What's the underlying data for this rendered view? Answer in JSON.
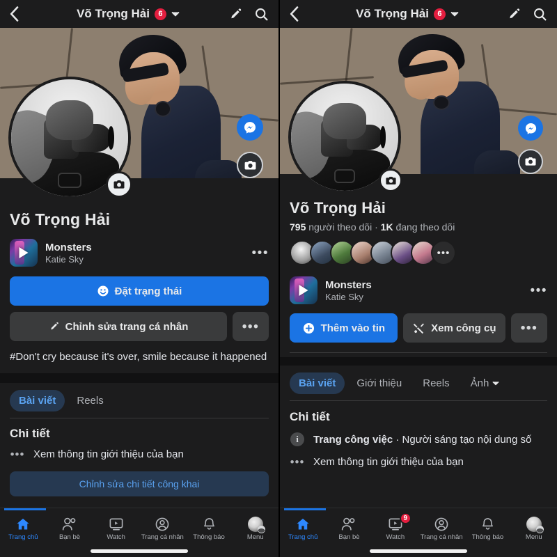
{
  "header": {
    "back_icon": "chevron-left-icon",
    "title": "Võ Trọng Hải",
    "badge": "6",
    "chevron_icon": "chevron-down-icon",
    "edit_icon": "pencil-icon",
    "search_icon": "search-icon"
  },
  "cover": {
    "messenger_icon": "messenger-icon",
    "camera_icon": "camera-icon",
    "avatar_camera_icon": "camera-icon",
    "alt": "man in navy shirt sitting on rocks adjusting sunglasses"
  },
  "profile": {
    "name": "Võ Trọng Hải",
    "followers_count": "795",
    "followers_label": "người theo dõi",
    "separator": "·",
    "following_count": "1K",
    "following_label": "đang theo dõi",
    "friends_more": "•••"
  },
  "music": {
    "title": "Monsters",
    "artist": "Katie Sky",
    "play_icon": "play-icon",
    "more_icon": "ellipsis-icon",
    "more_label": "•••"
  },
  "left_panel": {
    "status_button": "Đặt trạng thái",
    "status_icon": "smiley-icon",
    "edit_profile_button": "Chỉnh sửa trang cá nhân",
    "edit_profile_icon": "pencil-icon",
    "overflow_label": "•••",
    "bio": "#Don't cry because it's over, smile because it happened",
    "tabs": [
      {
        "label": "Bài viết",
        "active": true
      },
      {
        "label": "Reels",
        "active": false
      }
    ],
    "details_title": "Chi tiết",
    "details_rows": [
      {
        "icon": "ellipsis-icon",
        "text": "Xem thông tin giới thiệu của bạn"
      }
    ],
    "edit_public_details_button": "Chỉnh sửa chi tiết công khai"
  },
  "right_panel": {
    "add_story_button": "Thêm vào tin",
    "add_story_icon": "plus-circle-icon",
    "view_tools_button": "Xem công cụ",
    "view_tools_icon": "tools-icon",
    "overflow_label": "•••",
    "tabs": [
      {
        "label": "Bài viết",
        "active": true,
        "chevron": false
      },
      {
        "label": "Giới thiệu",
        "active": false,
        "chevron": false
      },
      {
        "label": "Reels",
        "active": false,
        "chevron": false
      },
      {
        "label": "Ảnh",
        "active": false,
        "chevron": true
      }
    ],
    "details_title": "Chi tiết",
    "details_rows": [
      {
        "icon": "info-icon",
        "bold": "Trang công việc",
        "text": " · Người sáng tạo nội dung số"
      },
      {
        "icon": "ellipsis-icon",
        "text": "Xem thông tin giới thiệu của bạn"
      }
    ]
  },
  "bottom_nav_left": [
    {
      "label": "Trang chủ",
      "icon": "home-icon",
      "active": true,
      "badge": ""
    },
    {
      "label": "Bạn bè",
      "icon": "friends-icon",
      "active": false,
      "badge": ""
    },
    {
      "label": "Watch",
      "icon": "watch-icon",
      "active": false,
      "badge": ""
    },
    {
      "label": "Trang cá nhân",
      "icon": "profile-icon",
      "active": false,
      "badge": ""
    },
    {
      "label": "Thông báo",
      "icon": "bell-icon",
      "active": false,
      "badge": ""
    },
    {
      "label": "Menu",
      "icon": "menu-avatar-icon",
      "active": false,
      "badge": ""
    }
  ],
  "bottom_nav_right": [
    {
      "label": "Trang chủ",
      "icon": "home-icon",
      "active": true,
      "badge": ""
    },
    {
      "label": "Bạn bè",
      "icon": "friends-icon",
      "active": false,
      "badge": ""
    },
    {
      "label": "Watch",
      "icon": "watch-icon",
      "active": false,
      "badge": "9"
    },
    {
      "label": "Trang cá nhân",
      "icon": "profile-icon",
      "active": false,
      "badge": ""
    },
    {
      "label": "Thông báo",
      "icon": "bell-icon",
      "active": false,
      "badge": ""
    },
    {
      "label": "Menu",
      "icon": "menu-avatar-icon",
      "active": false,
      "badge": ""
    }
  ],
  "colors": {
    "accent_blue": "#1b74e4",
    "link_blue": "#5aa2f0",
    "badge_red": "#e41e3f",
    "bg": "#1c1c1d",
    "surface": "#3a3b3c",
    "text": "#e8e9ea",
    "text_muted": "#b0b3b8"
  }
}
